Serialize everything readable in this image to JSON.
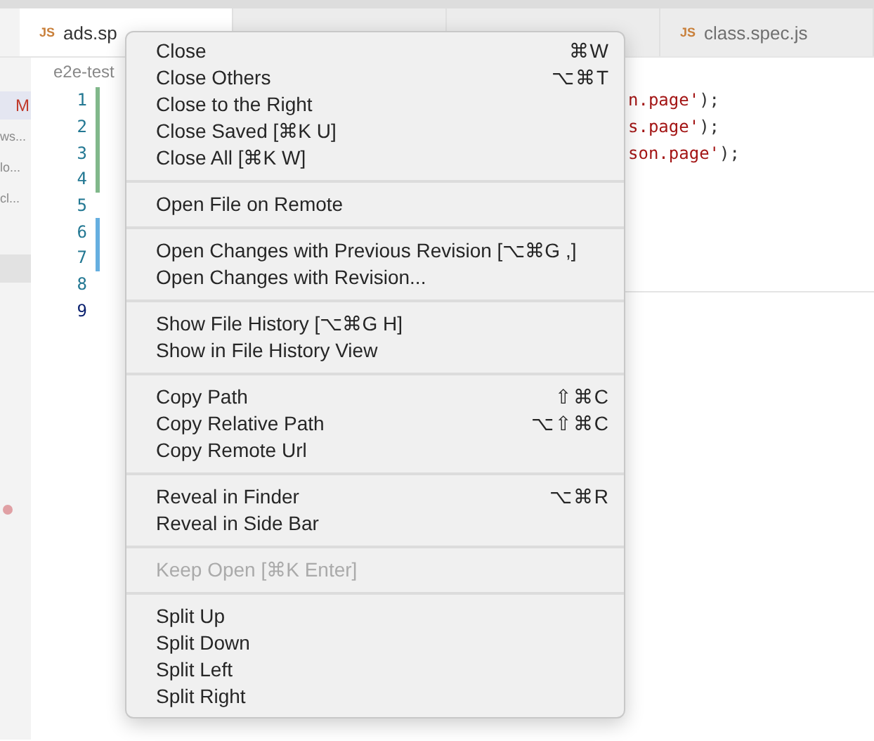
{
  "tabs": [
    {
      "label": "ads.sp",
      "badge": "JS",
      "selected": true
    },
    {
      "selected": false
    },
    {
      "selected": false
    },
    {
      "label": "class.spec.js",
      "badge": "JS",
      "selected": false
    }
  ],
  "breadcrumb": "e2e-test",
  "sidebar": {
    "items": [
      {
        "label": "M",
        "kind": "status",
        "selected": true
      },
      {
        "label": "ws...",
        "kind": "file",
        "selected": false
      },
      {
        "label": "lo...",
        "kind": "file",
        "selected": false
      },
      {
        "label": "cl...",
        "kind": "file",
        "selected": false
      }
    ]
  },
  "editor": {
    "lines": [
      {
        "number": "1",
        "kind": "added",
        "string": "n.page'",
        "punct": ");",
        "current": false
      },
      {
        "number": "2",
        "kind": "added",
        "string": "s.page'",
        "punct": ");",
        "current": false
      },
      {
        "number": "3",
        "kind": "added",
        "string": "son.page'",
        "punct": ");",
        "current": false
      },
      {
        "number": "4",
        "kind": "added",
        "current": false
      },
      {
        "number": "5",
        "kind": "plain",
        "current": false
      },
      {
        "number": "6",
        "kind": "modified",
        "current": false
      },
      {
        "number": "7",
        "kind": "modified",
        "current": false
      },
      {
        "number": "8",
        "kind": "plain",
        "current": false
      },
      {
        "number": "9",
        "kind": "plain",
        "current": true
      }
    ]
  },
  "context_menu": {
    "groups": [
      [
        {
          "label": "Close",
          "shortcut": "⌘W",
          "disabled": false
        },
        {
          "label": "Close Others",
          "shortcut": "⌥⌘T",
          "disabled": false
        },
        {
          "label": "Close to the Right",
          "disabled": false
        },
        {
          "label": "Close Saved [⌘K U]",
          "disabled": false
        },
        {
          "label": "Close All [⌘K W]",
          "disabled": false
        }
      ],
      [
        {
          "label": "Open File on Remote",
          "disabled": false
        }
      ],
      [
        {
          "label": "Open Changes with Previous Revision [⌥⌘G ,]",
          "disabled": false
        },
        {
          "label": "Open Changes with Revision...",
          "disabled": false
        }
      ],
      [
        {
          "label": "Show File History [⌥⌘G H]",
          "disabled": false
        },
        {
          "label": "Show in File History View",
          "disabled": false
        }
      ],
      [
        {
          "label": "Copy Path",
          "shortcut": "⇧⌘C",
          "disabled": false
        },
        {
          "label": "Copy Relative Path",
          "shortcut": "⌥⇧⌘C",
          "disabled": false
        },
        {
          "label": "Copy Remote Url",
          "disabled": false
        }
      ],
      [
        {
          "label": "Reveal in Finder",
          "shortcut": "⌥⌘R",
          "disabled": false
        },
        {
          "label": "Reveal in Side Bar",
          "disabled": false
        }
      ],
      [
        {
          "label": "Keep Open [⌘K Enter]",
          "disabled": true
        }
      ],
      [
        {
          "label": "Split Up",
          "disabled": false
        },
        {
          "label": "Split Down",
          "disabled": false
        },
        {
          "label": "Split Left",
          "disabled": false
        },
        {
          "label": "Split Right",
          "disabled": false
        }
      ]
    ]
  }
}
